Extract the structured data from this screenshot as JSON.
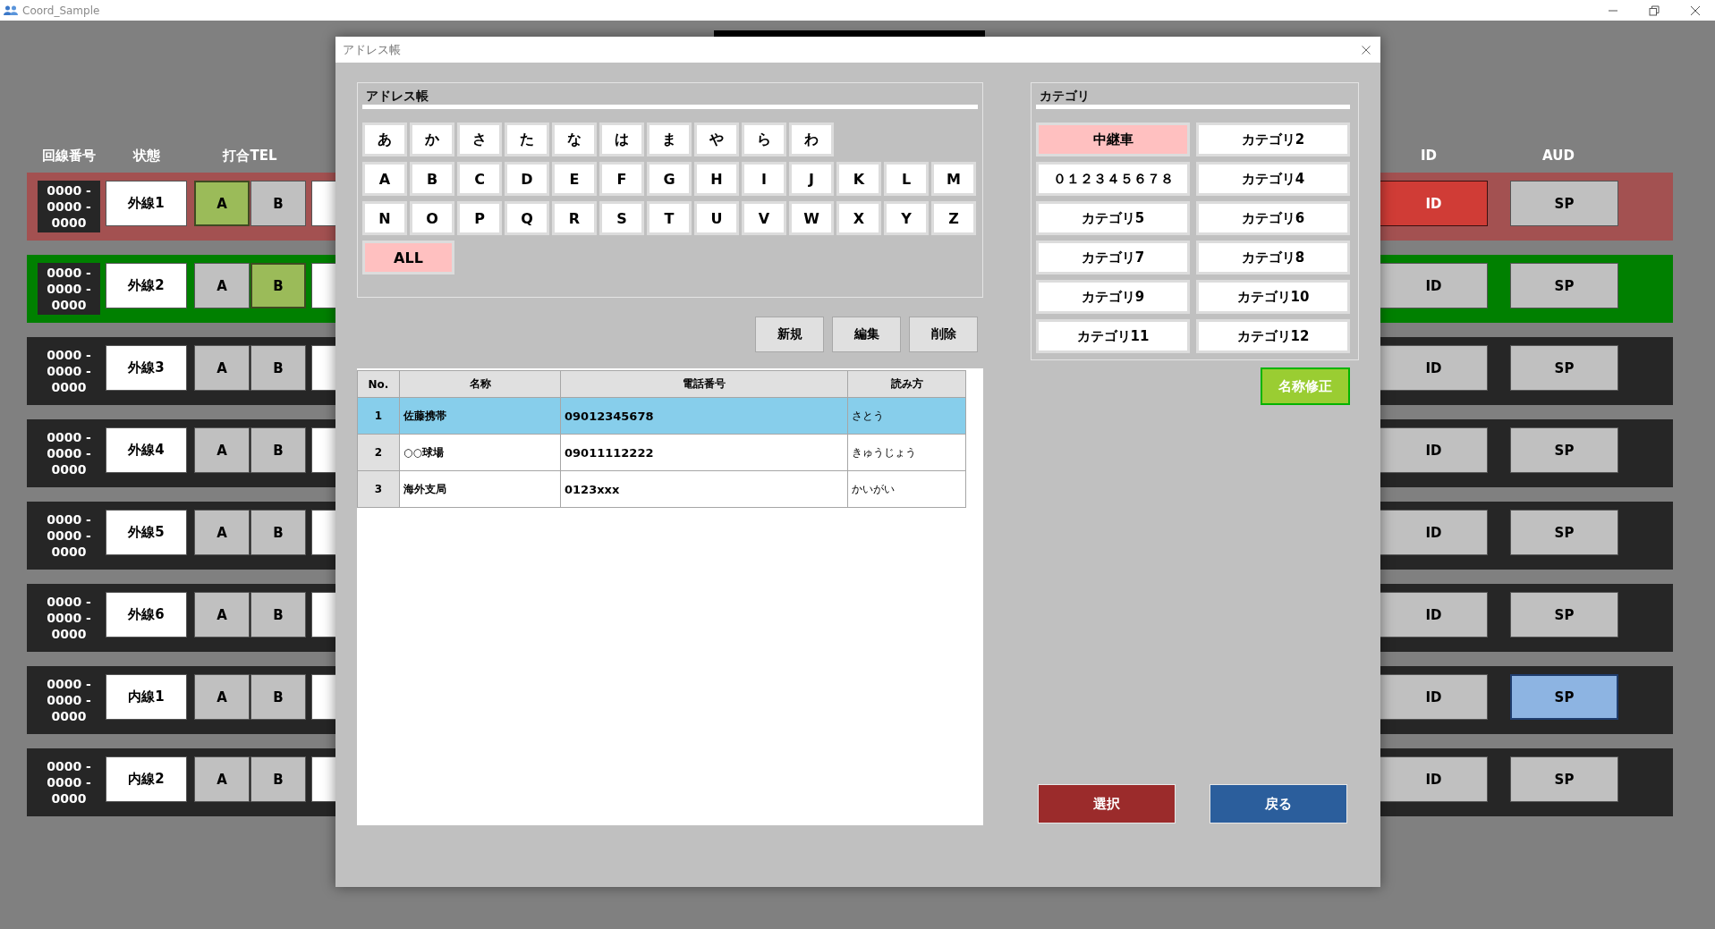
{
  "window": {
    "title": "Coord_Sample"
  },
  "line_panel": {
    "columns": [
      "回線番号",
      "状態",
      "打合TEL",
      "ID",
      "AUD"
    ],
    "rows": [
      {
        "number": "0000 - 0000 - 0000",
        "label": "外線1",
        "color": "#a35151",
        "tel": [
          {
            "label": "A",
            "selected": true
          },
          {
            "label": "B",
            "selected": false
          }
        ],
        "id": {
          "label": "ID",
          "on": true
        },
        "aud": {
          "label": "SP",
          "on": false
        }
      },
      {
        "number": "0000 - 0000 - 0000",
        "label": "外線2",
        "color": "#008000",
        "tel": [
          {
            "label": "A",
            "selected": false
          },
          {
            "label": "B",
            "selected": true
          }
        ],
        "id": {
          "label": "ID",
          "on": false
        },
        "aud": {
          "label": "SP",
          "on": false
        }
      },
      {
        "number": "0000 - 0000 - 0000",
        "label": "外線3",
        "color": "#262626",
        "tel": [
          {
            "label": "A",
            "selected": false
          },
          {
            "label": "B",
            "selected": false
          }
        ],
        "id": {
          "label": "ID",
          "on": false
        },
        "aud": {
          "label": "SP",
          "on": false
        }
      },
      {
        "number": "0000 - 0000 - 0000",
        "label": "外線4",
        "color": "#262626",
        "tel": [
          {
            "label": "A",
            "selected": false
          },
          {
            "label": "B",
            "selected": false
          }
        ],
        "id": {
          "label": "ID",
          "on": false
        },
        "aud": {
          "label": "SP",
          "on": false
        }
      },
      {
        "number": "0000 - 0000 - 0000",
        "label": "外線5",
        "color": "#262626",
        "tel": [
          {
            "label": "A",
            "selected": false
          },
          {
            "label": "B",
            "selected": false
          }
        ],
        "id": {
          "label": "ID",
          "on": false
        },
        "aud": {
          "label": "SP",
          "on": false
        }
      },
      {
        "number": "0000 - 0000 - 0000",
        "label": "外線6",
        "color": "#262626",
        "tel": [
          {
            "label": "A",
            "selected": false
          },
          {
            "label": "B",
            "selected": false
          }
        ],
        "id": {
          "label": "ID",
          "on": false
        },
        "aud": {
          "label": "SP",
          "on": false
        }
      },
      {
        "number": "0000 - 0000 - 0000",
        "label": "内線1",
        "color": "#262626",
        "tel": [
          {
            "label": "A",
            "selected": false
          },
          {
            "label": "B",
            "selected": false
          }
        ],
        "id": {
          "label": "ID",
          "on": false
        },
        "aud": {
          "label": "SP",
          "on": true
        }
      },
      {
        "number": "0000 - 0000 - 0000",
        "label": "内線2",
        "color": "#262626",
        "tel": [
          {
            "label": "A",
            "selected": false
          },
          {
            "label": "B",
            "selected": false
          }
        ],
        "id": {
          "label": "ID",
          "on": false
        },
        "aud": {
          "label": "SP",
          "on": false
        }
      }
    ]
  },
  "dialog": {
    "title": "アドレス帳",
    "address_book": {
      "title": "アドレス帳",
      "key_rows": [
        {
          "keys": [
            {
              "label": "あ",
              "selected": false
            },
            {
              "label": "か",
              "selected": false
            },
            {
              "label": "さ",
              "selected": false
            },
            {
              "label": "た",
              "selected": false
            },
            {
              "label": "な",
              "selected": false
            },
            {
              "label": "は",
              "selected": false
            },
            {
              "label": "ま",
              "selected": false
            },
            {
              "label": "や",
              "selected": false
            },
            {
              "label": "ら",
              "selected": false
            },
            {
              "label": "わ",
              "selected": false
            }
          ]
        },
        {
          "keys": [
            {
              "label": "A",
              "selected": false
            },
            {
              "label": "B",
              "selected": false
            },
            {
              "label": "C",
              "selected": false
            },
            {
              "label": "D",
              "selected": false
            },
            {
              "label": "E",
              "selected": false
            },
            {
              "label": "F",
              "selected": false
            },
            {
              "label": "G",
              "selected": false
            },
            {
              "label": "H",
              "selected": false
            },
            {
              "label": "I",
              "selected": false
            },
            {
              "label": "J",
              "selected": false
            },
            {
              "label": "K",
              "selected": false
            },
            {
              "label": "L",
              "selected": false
            },
            {
              "label": "M",
              "selected": false
            }
          ]
        },
        {
          "keys": [
            {
              "label": "N",
              "selected": false
            },
            {
              "label": "O",
              "selected": false
            },
            {
              "label": "P",
              "selected": false
            },
            {
              "label": "Q",
              "selected": false
            },
            {
              "label": "R",
              "selected": false
            },
            {
              "label": "S",
              "selected": false
            },
            {
              "label": "T",
              "selected": false
            },
            {
              "label": "U",
              "selected": false
            },
            {
              "label": "V",
              "selected": false
            },
            {
              "label": "W",
              "selected": false
            },
            {
              "label": "X",
              "selected": false
            },
            {
              "label": "Y",
              "selected": false
            },
            {
              "label": "Z",
              "selected": false
            }
          ]
        }
      ],
      "all_key": {
        "label": "ALL",
        "selected": true
      },
      "actions": [
        "新規",
        "編集",
        "削除"
      ],
      "table": {
        "columns": [
          "No.",
          "名称",
          "電話番号",
          "読み方"
        ],
        "rows": [
          {
            "cells": [
              "1",
              "佐藤携帯",
              "09012345678",
              "さとう"
            ],
            "selected": true
          },
          {
            "cells": [
              "2",
              "○○球場",
              "09011112222",
              "きゅうじょう"
            ],
            "selected": false
          },
          {
            "cells": [
              "3",
              "海外支局",
              "0123xxx",
              "かいがい"
            ],
            "selected": false
          }
        ]
      }
    },
    "category": {
      "title": "カテゴリ",
      "items": [
        {
          "label": "中継車",
          "selected": true
        },
        {
          "label": "カテゴリ2",
          "selected": false
        },
        {
          "label": "０１２３４５６７８",
          "selected": false
        },
        {
          "label": "カテゴリ4",
          "selected": false
        },
        {
          "label": "カテゴリ5",
          "selected": false
        },
        {
          "label": "カテゴリ6",
          "selected": false
        },
        {
          "label": "カテゴリ7",
          "selected": false
        },
        {
          "label": "カテゴリ8",
          "selected": false
        },
        {
          "label": "カテゴリ9",
          "selected": false
        },
        {
          "label": "カテゴリ10",
          "selected": false
        },
        {
          "label": "カテゴリ11",
          "selected": false
        },
        {
          "label": "カテゴリ12",
          "selected": false
        }
      ],
      "rename_button": "名称修正"
    },
    "footer_buttons": [
      {
        "label": "選択",
        "kind": "confirm"
      },
      {
        "label": "戻る",
        "kind": "back"
      }
    ]
  }
}
